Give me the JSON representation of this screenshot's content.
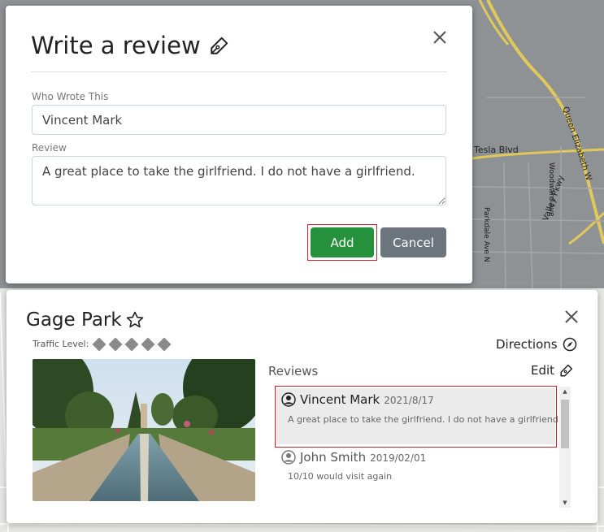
{
  "map": {
    "labels": [
      "Tesla Blvd",
      "Queen Elizabeth W",
      "Woodward Ave",
      "Parkdale Ave N",
      "Valley Pkwy"
    ]
  },
  "review_modal": {
    "title": "Write a review",
    "author_label": "Who Wrote This",
    "author_value": "Vincent Mark",
    "review_label": "Review",
    "review_value": "A great place to take the girlfriend. I do not have a girlfriend.",
    "add_label": "Add",
    "cancel_label": "Cancel"
  },
  "park": {
    "name": "Gage Park",
    "traffic_label": "Traffic Level:",
    "traffic_level": 5,
    "directions_label": "Directions",
    "reviews_heading": "Reviews",
    "edit_label": "Edit",
    "reviews": [
      {
        "author": "Vincent Mark",
        "date": "2021/8/17",
        "text": "A great place to take the girlfriend. I do not have a girlfriend.",
        "selected": true
      },
      {
        "author": "John Smith",
        "date": "2019/02/01",
        "text": "10/10 would visit again",
        "selected": false
      }
    ]
  },
  "colors": {
    "add_button": "#26913c",
    "cancel_button": "#6c757d",
    "highlight_outline": "#c8232c",
    "map_water": "#8e9295",
    "road_yellow": "#e0c85a"
  }
}
